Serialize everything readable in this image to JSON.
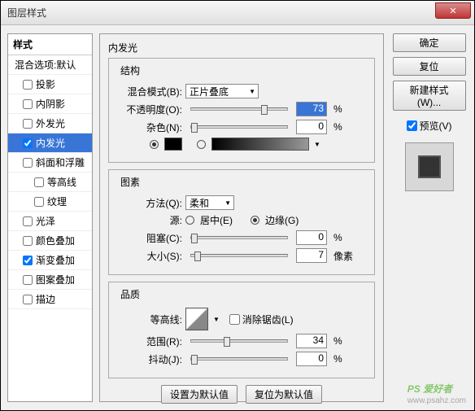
{
  "window": {
    "title": "图层样式"
  },
  "sidebar": {
    "header": "样式",
    "blend_options": "混合选项:默认",
    "items": [
      {
        "label": "投影",
        "checked": false
      },
      {
        "label": "内阴影",
        "checked": false
      },
      {
        "label": "外发光",
        "checked": false
      },
      {
        "label": "内发光",
        "checked": true,
        "selected": true
      },
      {
        "label": "斜面和浮雕",
        "checked": false
      },
      {
        "label": "等高线",
        "checked": false,
        "sub": true
      },
      {
        "label": "纹理",
        "checked": false,
        "sub": true
      },
      {
        "label": "光泽",
        "checked": false
      },
      {
        "label": "颜色叠加",
        "checked": false
      },
      {
        "label": "渐变叠加",
        "checked": true
      },
      {
        "label": "图案叠加",
        "checked": false
      },
      {
        "label": "描边",
        "checked": false
      }
    ]
  },
  "panel": {
    "title": "内发光",
    "structure": {
      "legend": "结构",
      "blend_mode_label": "混合模式(B):",
      "blend_mode_value": "正片叠底",
      "opacity_label": "不透明度(O):",
      "opacity_value": "73",
      "opacity_unit": "%",
      "noise_label": "杂色(N):",
      "noise_value": "0",
      "noise_unit": "%"
    },
    "elements": {
      "legend": "图素",
      "technique_label": "方法(Q):",
      "technique_value": "柔和",
      "source_label": "源:",
      "source_center": "居中(E)",
      "source_edge": "边缘(G)",
      "choke_label": "阻塞(C):",
      "choke_value": "0",
      "choke_unit": "%",
      "size_label": "大小(S):",
      "size_value": "7",
      "size_unit": "像素"
    },
    "quality": {
      "legend": "品质",
      "contour_label": "等高线:",
      "antialias_label": "消除锯齿(L)",
      "range_label": "范围(R):",
      "range_value": "34",
      "range_unit": "%",
      "jitter_label": "抖动(J):",
      "jitter_value": "0",
      "jitter_unit": "%"
    },
    "set_default": "设置为默认值",
    "reset_default": "复位为默认值"
  },
  "right": {
    "ok": "确定",
    "cancel": "复位",
    "new_style": "新建样式(W)...",
    "preview": "预览(V)"
  },
  "watermark": {
    "main": "PS 爱好者",
    "url": "www.psahz.com"
  }
}
